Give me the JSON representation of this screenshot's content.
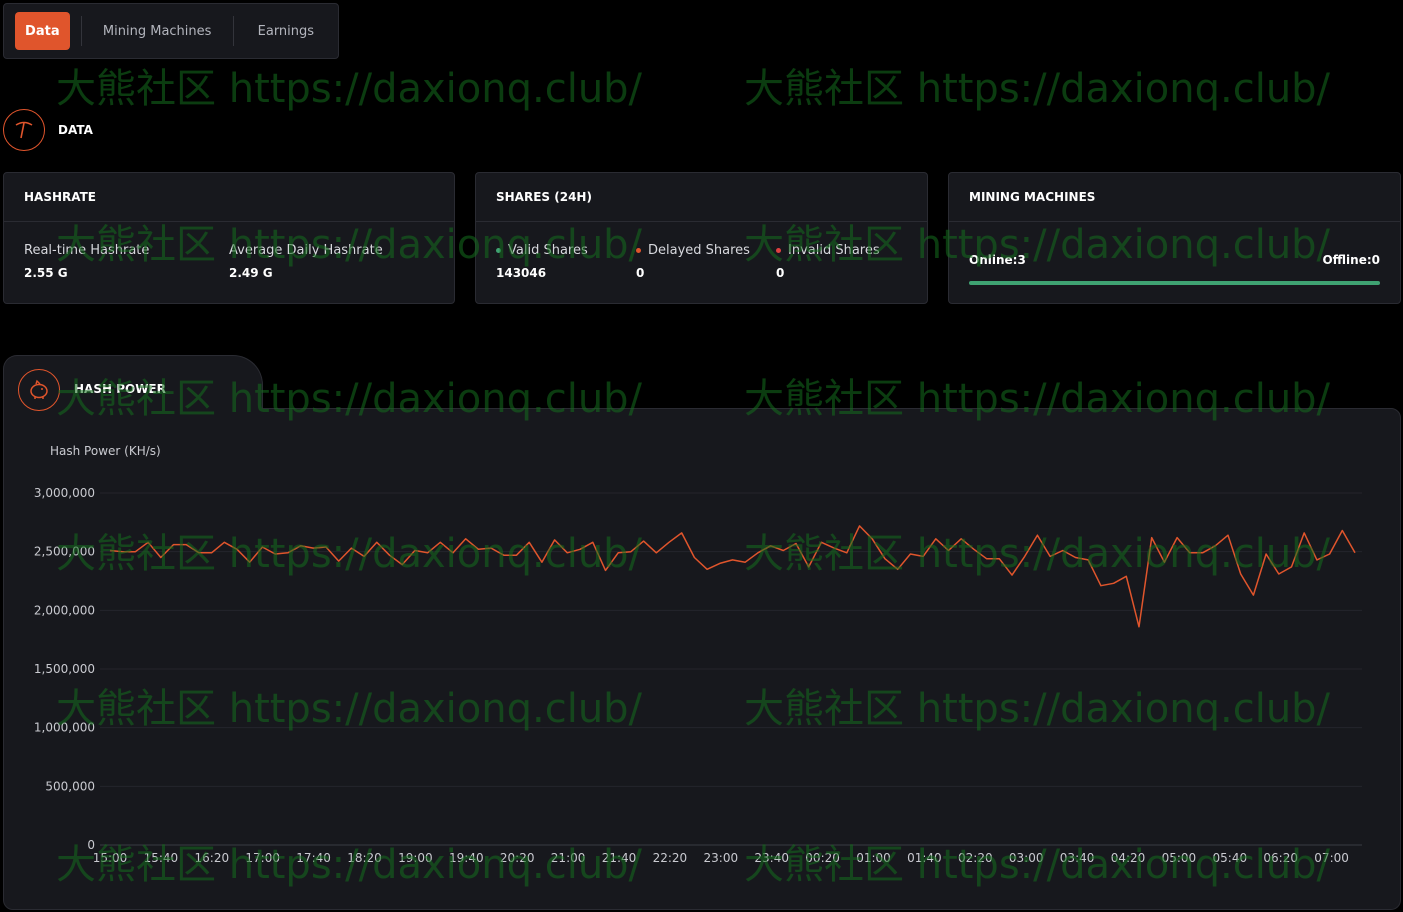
{
  "tabs": [
    {
      "label": "Data",
      "active": true
    },
    {
      "label": "Mining Machines",
      "active": false
    },
    {
      "label": "Earnings",
      "active": false
    }
  ],
  "data_section": {
    "title": "DATA",
    "icon": "pickaxe-icon"
  },
  "hashrate": {
    "title": "HASHRATE",
    "realtime_label": "Real-time Hashrate",
    "realtime_value": "2.55 G",
    "average_label": "Average Daily Hashrate",
    "average_value": "2.49 G"
  },
  "shares": {
    "title": "SHARES (24H)",
    "valid_label": "Valid Shares",
    "valid_value": "143046",
    "delayed_label": "Delayed Shares",
    "delayed_value": "0",
    "invalid_label": "Invalid Shares",
    "invalid_value": "0"
  },
  "machines": {
    "title": "MINING MACHINES",
    "online": "Online:3",
    "offline": "Offline:0",
    "online_fraction": 1.0
  },
  "hash_power": {
    "title": "HASH POWER",
    "icon": "piggy-bank-icon"
  },
  "watermark_text": "大熊社区 https://daxionq.club/",
  "colors": {
    "accent": "#e0552c",
    "valid": "#3fa272",
    "delayed": "#e0552c",
    "invalid": "#e04040",
    "line": "#e0552c"
  },
  "chart_data": {
    "type": "line",
    "ylabel": "Hash Power (KH/s)",
    "ylim": [
      0,
      3000000
    ],
    "yticks": [
      0,
      500000,
      1000000,
      1500000,
      2000000,
      2500000,
      3000000
    ],
    "ytick_labels": [
      "0",
      "500,000",
      "1,000,000",
      "1,500,000",
      "2,000,000",
      "2,500,000",
      "3,000,000"
    ],
    "xtick_labels": [
      "15:00",
      "15:40",
      "16:20",
      "17:00",
      "17:40",
      "18:20",
      "19:00",
      "19:40",
      "20:20",
      "21:00",
      "21:40",
      "22:20",
      "23:00",
      "23:40",
      "00:20",
      "01:00",
      "01:40",
      "02:20",
      "03:00",
      "03:40",
      "04:20",
      "05:00",
      "05:40",
      "06:20",
      "07:00"
    ],
    "series": [
      {
        "values": [
          2510000,
          2500000,
          2500000,
          2580000,
          2450000,
          2560000,
          2560000,
          2490000,
          2490000,
          2580000,
          2520000,
          2410000,
          2540000,
          2480000,
          2490000,
          2550000,
          2530000,
          2540000,
          2420000,
          2530000,
          2460000,
          2580000,
          2470000,
          2390000,
          2510000,
          2490000,
          2580000,
          2490000,
          2610000,
          2520000,
          2530000,
          2470000,
          2470000,
          2580000,
          2410000,
          2600000,
          2490000,
          2520000,
          2580000,
          2340000,
          2490000,
          2500000,
          2590000,
          2490000,
          2580000,
          2660000,
          2450000,
          2350000,
          2400000,
          2430000,
          2410000,
          2490000,
          2550000,
          2510000,
          2570000,
          2370000,
          2580000,
          2530000,
          2490000,
          2720000,
          2610000,
          2440000,
          2350000,
          2480000,
          2460000,
          2610000,
          2510000,
          2610000,
          2520000,
          2440000,
          2440000,
          2300000,
          2460000,
          2640000,
          2460000,
          2510000,
          2450000,
          2430000,
          2210000,
          2230000,
          2290000,
          1860000,
          2620000,
          2410000,
          2620000,
          2490000,
          2490000,
          2550000,
          2640000,
          2310000,
          2130000,
          2480000,
          2310000,
          2370000,
          2660000,
          2430000,
          2480000,
          2680000,
          2490000
        ]
      }
    ],
    "grid": true
  }
}
